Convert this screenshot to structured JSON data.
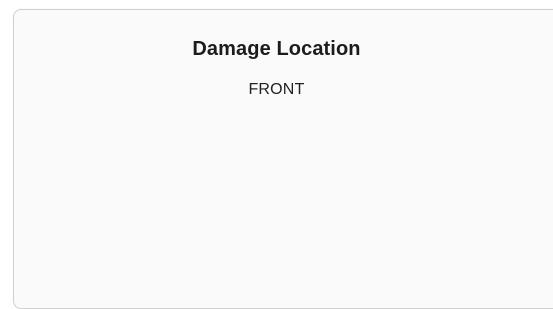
{
  "card": {
    "title": "Damage Location",
    "value": "FRONT"
  }
}
